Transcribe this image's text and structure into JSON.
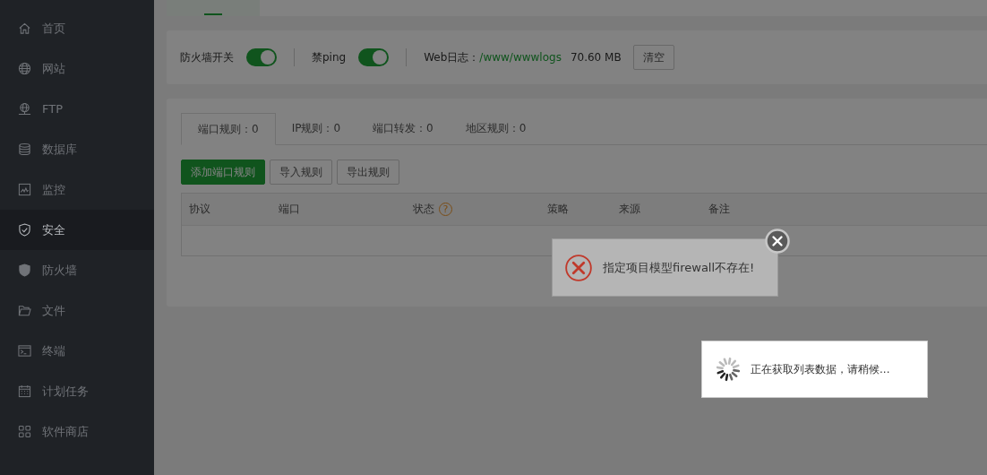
{
  "sidebar": {
    "items": [
      {
        "label": "首页",
        "kind": "home",
        "selected": false
      },
      {
        "label": "网站",
        "kind": "globe",
        "selected": false
      },
      {
        "label": "FTP",
        "kind": "ftp",
        "selected": false
      },
      {
        "label": "数据库",
        "kind": "database",
        "selected": false
      },
      {
        "label": "监控",
        "kind": "monitor",
        "selected": false
      },
      {
        "label": "安全",
        "kind": "shield",
        "selected": true
      },
      {
        "label": "防火墙",
        "kind": "firewall",
        "selected": false
      },
      {
        "label": "文件",
        "kind": "folder",
        "selected": false
      },
      {
        "label": "终端",
        "kind": "terminal",
        "selected": false
      },
      {
        "label": "计划任务",
        "kind": "calendar",
        "selected": false
      },
      {
        "label": "软件商店",
        "kind": "apps",
        "selected": false
      }
    ]
  },
  "settings": {
    "firewall_label": "防火墙开关",
    "firewall_on": true,
    "ping_label": "禁ping",
    "ping_on": true,
    "log_label": "Web日志：",
    "log_path": "/www/wwwlogs",
    "log_size": "70.60 MB",
    "clear_button": "清空"
  },
  "rule_tabs": [
    {
      "label": "端口规则：0",
      "selected": true
    },
    {
      "label": "IP规则：0",
      "selected": false
    },
    {
      "label": "端口转发：0",
      "selected": false
    },
    {
      "label": "地区规则：0",
      "selected": false
    }
  ],
  "actions": [
    {
      "label": "添加端口规则",
      "primary": true
    },
    {
      "label": "导入规则",
      "primary": false
    },
    {
      "label": "导出规则",
      "primary": false
    }
  ],
  "table": {
    "columns": [
      {
        "label": "协议"
      },
      {
        "label": "端口"
      },
      {
        "label": "状态",
        "help_mark": "?"
      },
      {
        "label": "策略"
      },
      {
        "label": "来源"
      },
      {
        "label": "备注"
      }
    ]
  },
  "error_toast": {
    "message": "指定项目模型firewall不存在!"
  },
  "loading": {
    "message": "正在获取列表数据，请稍候..."
  }
}
